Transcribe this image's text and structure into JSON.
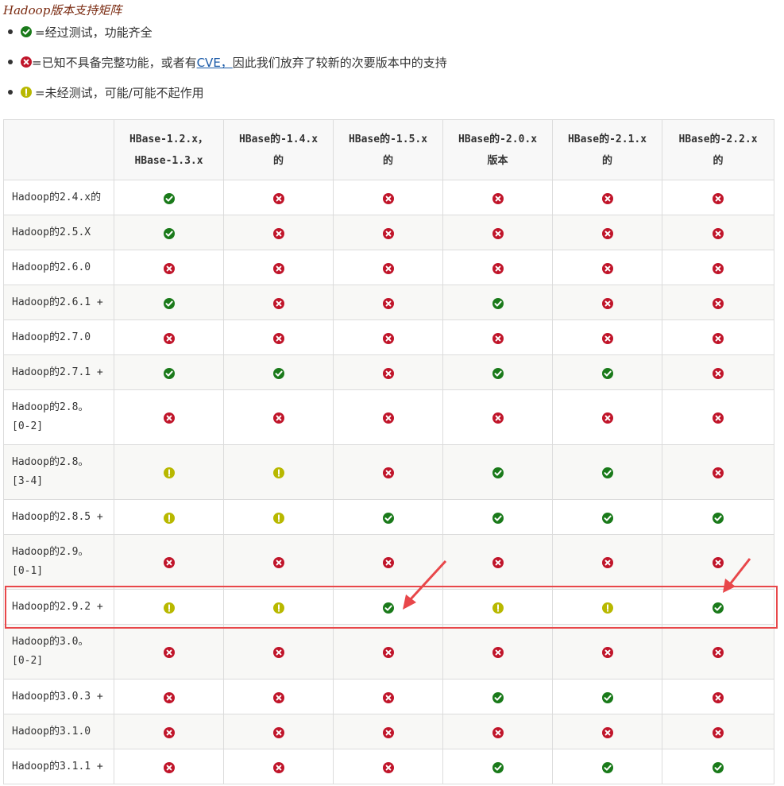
{
  "title": "Hadoop版本支持矩阵",
  "legend": [
    {
      "icon": "check",
      "text": "=经过测试，功能齐全"
    },
    {
      "icon": "cross",
      "text_before": "=已知不具备完整功能，或者有",
      "link": "CVE，",
      "text_after": "因此我们放弃了较新的次要版本中的支持"
    },
    {
      "icon": "warn",
      "text": "=未经测试，可能/可能不起作用"
    }
  ],
  "colors": {
    "check": "#1a7a1a",
    "cross": "#c0152a",
    "warn": "#b8b800",
    "highlight": "#e8474a"
  },
  "columns": [
    {
      "line1": "HBase-1.2.x，",
      "line2": "HBase-1.3.x"
    },
    {
      "line1": "HBase的-1.4.x",
      "line2": "的"
    },
    {
      "line1": "HBase的-1.5.x",
      "line2": "的"
    },
    {
      "line1": "HBase的-2.0.x",
      "line2": "版本"
    },
    {
      "line1": "HBase的-2.1.x",
      "line2": "的"
    },
    {
      "line1": "HBase的-2.2.x",
      "line2": "的"
    }
  ],
  "rows": [
    {
      "label1": "Hadoop的2.4.x的",
      "label2": "",
      "cells": [
        "check",
        "cross",
        "cross",
        "cross",
        "cross",
        "cross"
      ]
    },
    {
      "label1": "Hadoop的2.5.X",
      "label2": "",
      "cells": [
        "check",
        "cross",
        "cross",
        "cross",
        "cross",
        "cross"
      ]
    },
    {
      "label1": "Hadoop的2.6.0",
      "label2": "",
      "cells": [
        "cross",
        "cross",
        "cross",
        "cross",
        "cross",
        "cross"
      ]
    },
    {
      "label1": "Hadoop的2.6.1 +",
      "label2": "",
      "cells": [
        "check",
        "cross",
        "cross",
        "check",
        "cross",
        "cross"
      ]
    },
    {
      "label1": "Hadoop的2.7.0",
      "label2": "",
      "cells": [
        "cross",
        "cross",
        "cross",
        "cross",
        "cross",
        "cross"
      ]
    },
    {
      "label1": "Hadoop的2.7.1 +",
      "label2": "",
      "cells": [
        "check",
        "check",
        "cross",
        "check",
        "check",
        "cross"
      ]
    },
    {
      "label1": "Hadoop的2.8。",
      "label2": "[0-2]",
      "cells": [
        "cross",
        "cross",
        "cross",
        "cross",
        "cross",
        "cross"
      ]
    },
    {
      "label1": "Hadoop的2.8。",
      "label2": "[3-4]",
      "cells": [
        "warn",
        "warn",
        "cross",
        "check",
        "check",
        "cross"
      ]
    },
    {
      "label1": "Hadoop的2.8.5 +",
      "label2": "",
      "cells": [
        "warn",
        "warn",
        "check",
        "check",
        "check",
        "check"
      ]
    },
    {
      "label1": "Hadoop的2.9。",
      "label2": "[0-1]",
      "cells": [
        "cross",
        "cross",
        "cross",
        "cross",
        "cross",
        "cross"
      ]
    },
    {
      "label1": "Hadoop的2.9.2 +",
      "label2": "",
      "cells": [
        "warn",
        "warn",
        "check",
        "warn",
        "warn",
        "check"
      ]
    },
    {
      "label1": "Hadoop的3.0。",
      "label2": "[0-2]",
      "cells": [
        "cross",
        "cross",
        "cross",
        "cross",
        "cross",
        "cross"
      ]
    },
    {
      "label1": "Hadoop的3.0.3 +",
      "label2": "",
      "cells": [
        "cross",
        "cross",
        "cross",
        "check",
        "check",
        "cross"
      ]
    },
    {
      "label1": "Hadoop的3.1.0",
      "label2": "",
      "cells": [
        "cross",
        "cross",
        "cross",
        "cross",
        "cross",
        "cross"
      ]
    },
    {
      "label1": "Hadoop的3.1.1 +",
      "label2": "",
      "cells": [
        "cross",
        "cross",
        "cross",
        "check",
        "check",
        "check"
      ]
    }
  ]
}
